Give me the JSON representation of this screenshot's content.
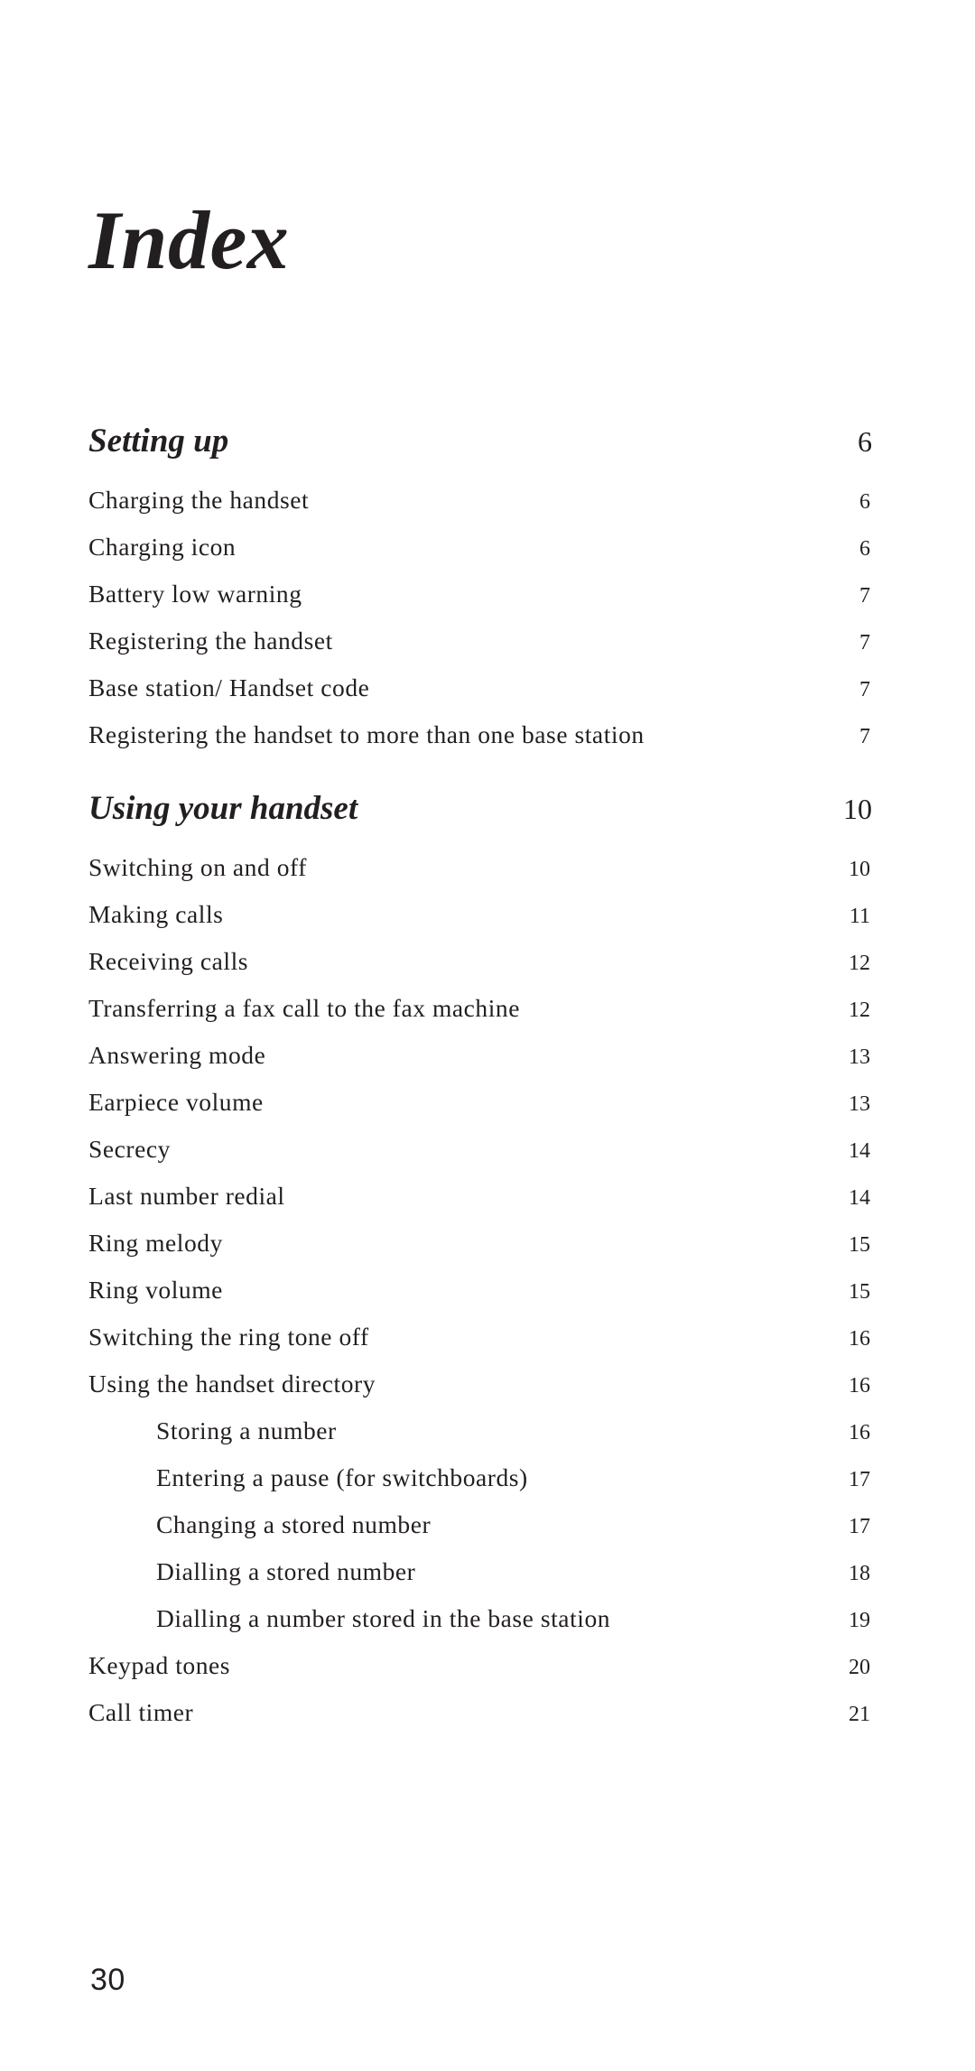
{
  "document": {
    "title": "Index",
    "folio": "30"
  },
  "sections": [
    {
      "heading": "Setting up",
      "page": "6",
      "entries": [
        {
          "label": "Charging the handset",
          "page": "6",
          "level": 1
        },
        {
          "label": "Charging icon",
          "page": "6",
          "level": 1
        },
        {
          "label": "Battery low warning",
          "page": "7",
          "level": 1
        },
        {
          "label": "Registering the handset",
          "page": "7",
          "level": 1
        },
        {
          "label": "Base station/ Handset code",
          "page": "7",
          "level": 1
        },
        {
          "label": "Registering the handset to more than one base station",
          "page": "7",
          "level": 1
        }
      ]
    },
    {
      "heading": "Using your handset",
      "page": "10",
      "entries": [
        {
          "label": "Switching on and off",
          "page": "10",
          "level": 1
        },
        {
          "label": "Making calls",
          "page": "11",
          "level": 1
        },
        {
          "label": "Receiving calls",
          "page": "12",
          "level": 1
        },
        {
          "label": "Transferring a fax call to the fax machine",
          "page": "12",
          "level": 1
        },
        {
          "label": "Answering mode",
          "page": "13",
          "level": 1
        },
        {
          "label": "Earpiece volume",
          "page": "13",
          "level": 1
        },
        {
          "label": "Secrecy",
          "page": "14",
          "level": 1
        },
        {
          "label": "Last number redial",
          "page": "14",
          "level": 1
        },
        {
          "label": "Ring melody",
          "page": "15",
          "level": 1
        },
        {
          "label": "Ring volume",
          "page": "15",
          "level": 1
        },
        {
          "label": "Switching the ring tone off",
          "page": "16",
          "level": 1
        },
        {
          "label": "Using the handset directory",
          "page": "16",
          "level": 1
        },
        {
          "label": "Storing a number",
          "page": "16",
          "level": 2
        },
        {
          "label": "Entering a pause (for switchboards)",
          "page": "17",
          "level": 2
        },
        {
          "label": "Changing a stored number",
          "page": "17",
          "level": 2
        },
        {
          "label": "Dialling a stored number",
          "page": "18",
          "level": 2
        },
        {
          "label": "Dialling a number stored in the base station",
          "page": "19",
          "level": 2
        },
        {
          "label": "Keypad tones",
          "page": "20",
          "level": 1
        },
        {
          "label": "Call timer",
          "page": "21",
          "level": 1
        }
      ]
    }
  ]
}
